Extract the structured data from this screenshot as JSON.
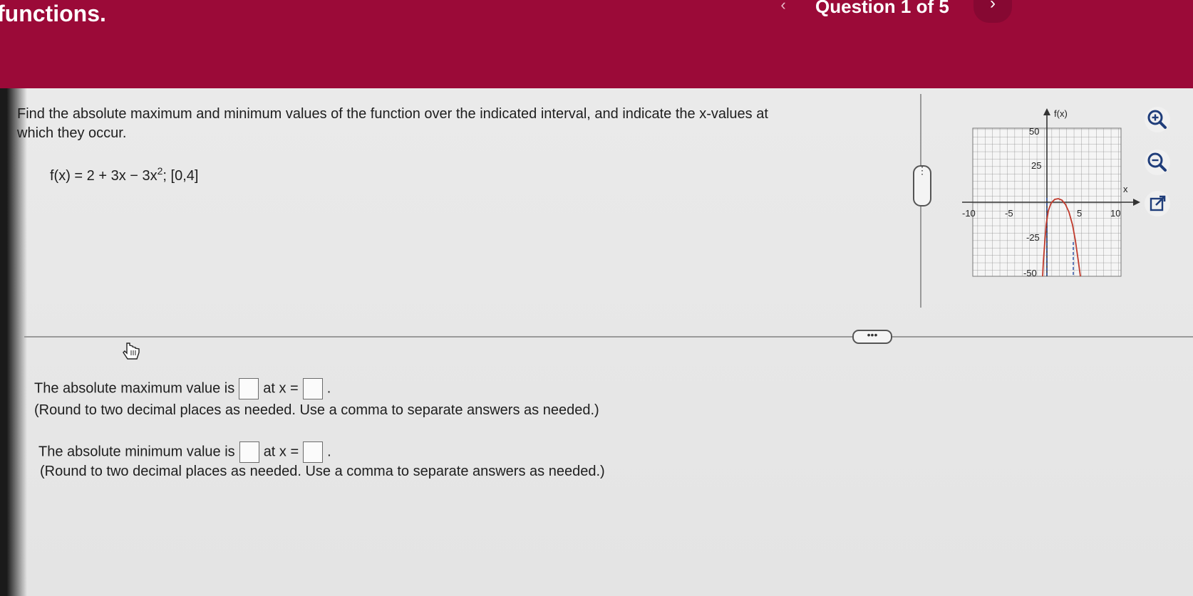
{
  "header": {
    "title": "functions.",
    "question_label": "Question 1 of 5",
    "prev_glyph": "‹",
    "next_glyph": "›",
    "color": "#9b0a38"
  },
  "problem": {
    "instruction_line1": "Find the absolute maximum and minimum values of the function over the indicated interval, and indicate the x-values at",
    "instruction_line2": "which they occur.",
    "function_base": "f(x) = 2 + 3x − 3x",
    "function_exponent": "2",
    "function_interval": "; [0,4]"
  },
  "graph": {
    "y_axis_label": "f(x)",
    "x_axis_label": "x",
    "y_tick_labels": [
      "50",
      "25",
      "-25",
      "-50"
    ],
    "x_tick_labels": [
      "-10",
      "-5",
      "5",
      "10"
    ],
    "curve_color": "#c0392b",
    "dashed_color": "#2b4fa8"
  },
  "tools": {
    "zoom_in": "zoom-in-icon",
    "zoom_out": "zoom-out-icon",
    "popout": "external-link-icon"
  },
  "dividers": {
    "handle_glyph": "•••"
  },
  "answers": {
    "max_prefix": "The absolute maximum value is",
    "max_mid": "at x =",
    "max_end": ".",
    "max_note": "(Round to two decimal places as needed. Use a comma to separate answers as needed.)",
    "min_prefix": "The absolute minimum value is",
    "min_mid": "at x =",
    "min_end": ".",
    "min_note": "(Round to two decimal places as needed. Use a comma to separate answers as needed.)"
  }
}
